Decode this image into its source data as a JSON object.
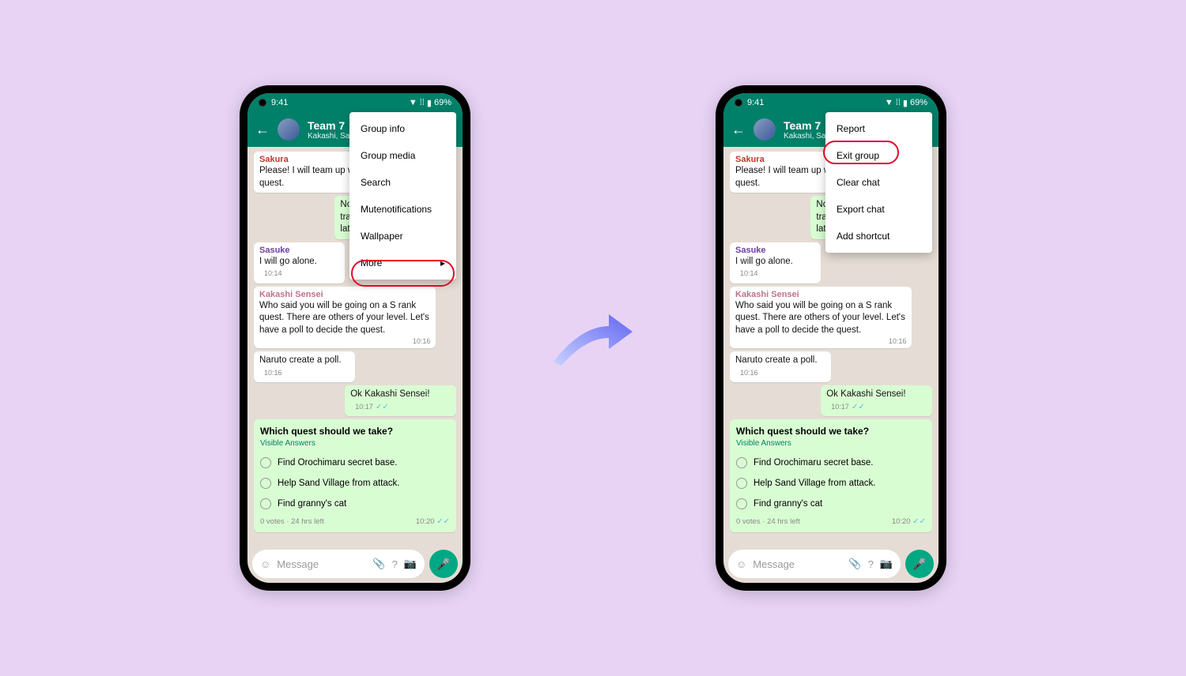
{
  "status": {
    "time": "9:41",
    "battery": "69%"
  },
  "chat": {
    "title": "Team 7",
    "subtitle": "Kakashi, Sakura, Sasu",
    "messages": {
      "m1": {
        "sender": "Sakura",
        "text": "Please! I will team up with your S rank quest."
      },
      "m2": {
        "text": "No I will go with you. I'll train with Jiraya sensei later."
      },
      "m3": {
        "sender": "Sasuke",
        "text": "I will go alone.",
        "time": "10:14"
      },
      "m4": {
        "sender": "Kakashi Sensei",
        "text": "Who said you will be going on a S rank quest. There are others of your level. Let's have a poll to decide the quest.",
        "time": "10:16"
      },
      "m5": {
        "text": "Naruto create a poll.",
        "time": "10:16"
      },
      "m6": {
        "text": "Ok Kakashi Sensei!",
        "time": "10:17"
      }
    },
    "poll": {
      "question": "Which quest should we take?",
      "visible": "Visible Answers",
      "options": [
        "Find Orochimaru secret base.",
        "Help Sand Village from attack.",
        "Find granny's cat"
      ],
      "meta": "0 votes · 24 hrs left",
      "time": "10:20"
    },
    "input_placeholder": "Message"
  },
  "menu1": [
    "Group info",
    "Group media",
    "Search",
    "Mutenotifications",
    "Wallpaper",
    "More"
  ],
  "menu2": [
    "Report",
    "Exit group",
    "Clear chat",
    "Export chat",
    "Add shortcut"
  ]
}
